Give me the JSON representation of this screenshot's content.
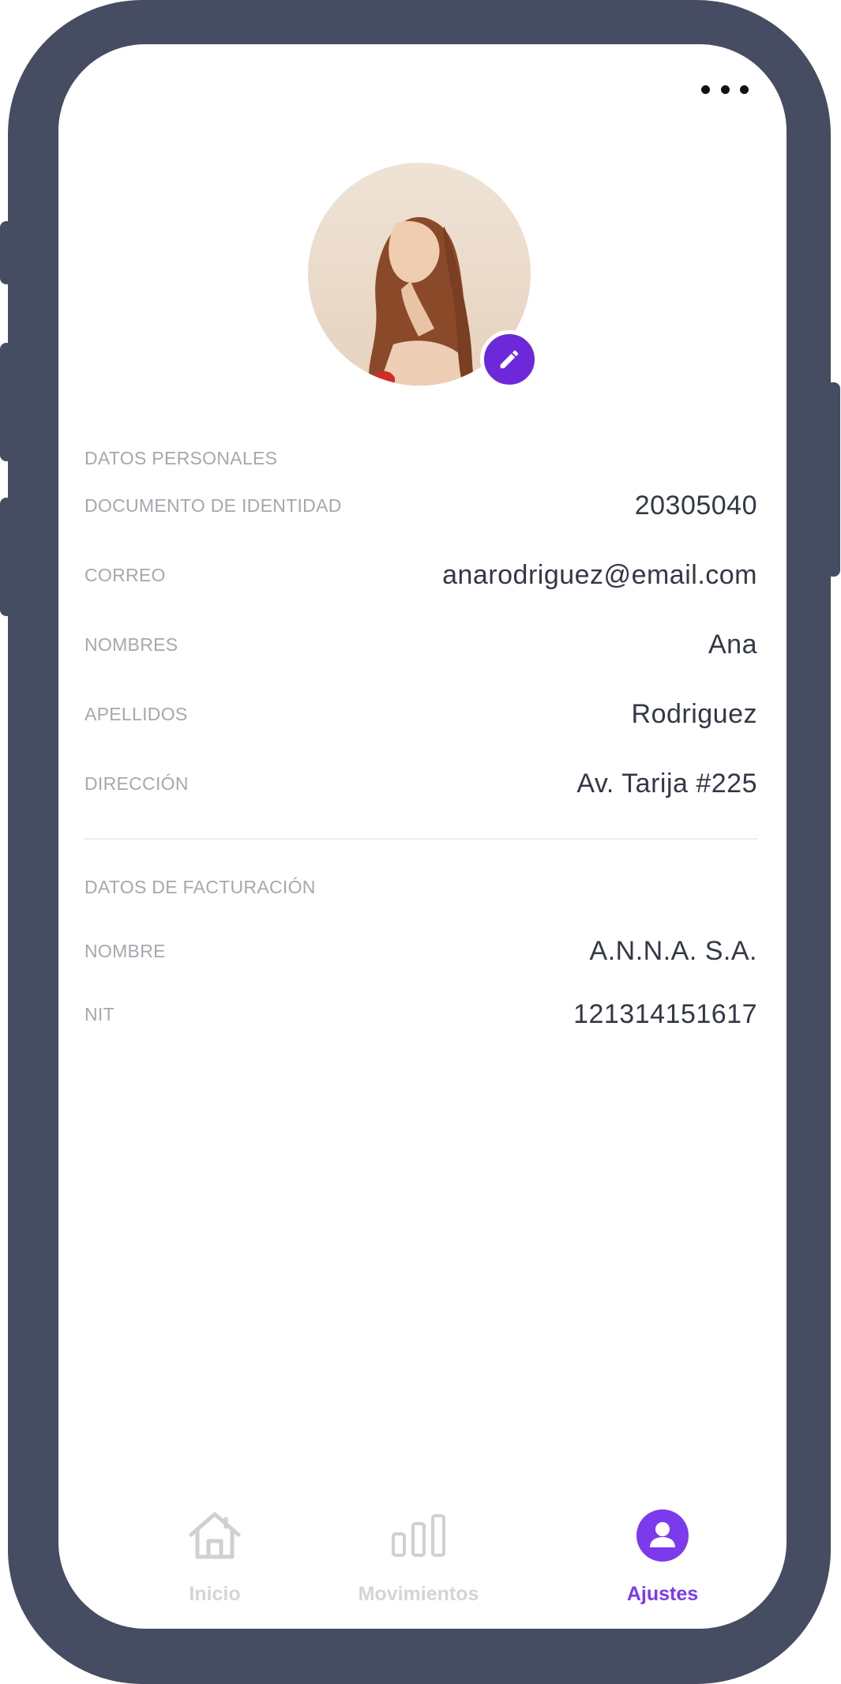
{
  "header": {
    "more_icon": "more-horizontal-icon"
  },
  "profile": {
    "avatar": "profile-photo",
    "edit_icon": "pencil-icon"
  },
  "personal": {
    "title": "DATOS PERSONALES",
    "fields": [
      {
        "label": "DOCUMENTO DE IDENTIDAD",
        "value": "20305040"
      },
      {
        "label": "CORREO",
        "value": "anarodriguez@email.com"
      },
      {
        "label": "NOMBRES",
        "value": "Ana"
      },
      {
        "label": "APELLIDOS",
        "value": "Rodriguez"
      },
      {
        "label": "DIRECCIÓN",
        "value": "Av. Tarija #225"
      }
    ]
  },
  "billing": {
    "title": "DATOS DE FACTURACIÓN",
    "fields": [
      {
        "label": "NOMBRE",
        "value": "A.N.N.A. S.A."
      },
      {
        "label": "NIT",
        "value": "121314151617"
      }
    ]
  },
  "nav": {
    "items": [
      {
        "label": "Inicio",
        "icon": "home-icon",
        "active": false
      },
      {
        "label": "Movimientos",
        "icon": "bar-chart-icon",
        "active": false
      },
      {
        "label": "Ajustes",
        "icon": "user-circle-icon",
        "active": true
      }
    ]
  },
  "colors": {
    "frame": "#464c61",
    "accent": "#7c3aed",
    "label": "#a6a8ae",
    "value": "#333845",
    "nav_inactive": "#d4d4d9"
  }
}
